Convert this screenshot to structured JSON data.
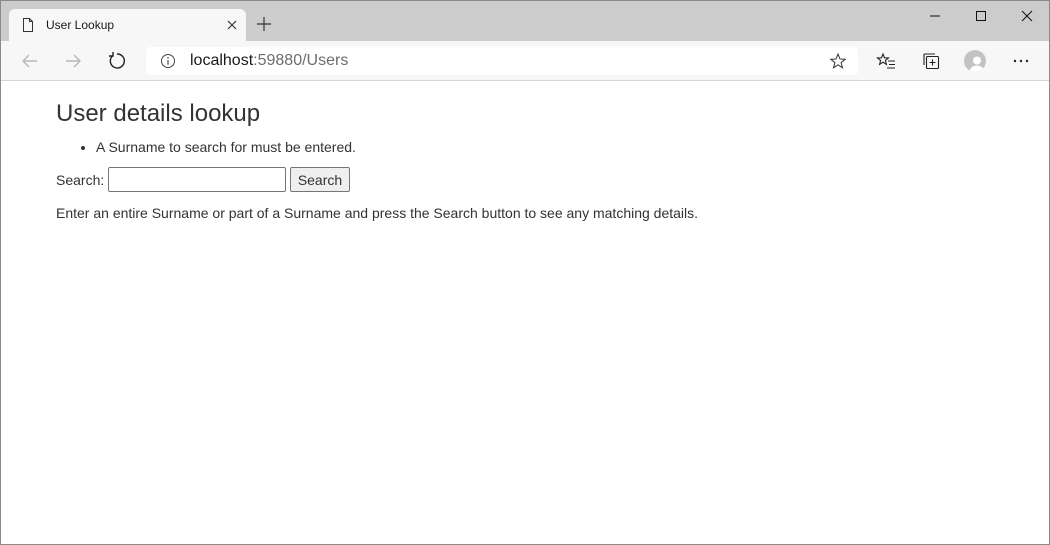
{
  "browser": {
    "tab": {
      "title": "User Lookup",
      "page_icon": "page-icon",
      "close_icon": "close-icon"
    },
    "new_tab_icon": "plus-icon",
    "window_controls": [
      "minimize-icon",
      "maximize-icon",
      "close-icon"
    ],
    "address_bar": {
      "host": "localhost",
      "path": ":59880/Users",
      "info_icon": "info-icon",
      "favorite_icon": "star-icon"
    },
    "toolbar_icons": [
      "back-arrow-icon",
      "forward-arrow-icon",
      "reload-icon",
      "favorites-icon",
      "collections-icon",
      "profile-icon",
      "more-icon"
    ]
  },
  "page": {
    "title": "User details lookup",
    "validation_errors": [
      "A Surname to search for must be entered."
    ],
    "search": {
      "label": "Search:",
      "value": "",
      "button_label": "Search"
    },
    "help_text": "Enter an entire Surname or part of a Surname and press the Search button to see any matching details."
  },
  "colors": {
    "tabstrip": "#cccccc",
    "toolbar": "#f7f7f7",
    "text": "#333333"
  }
}
